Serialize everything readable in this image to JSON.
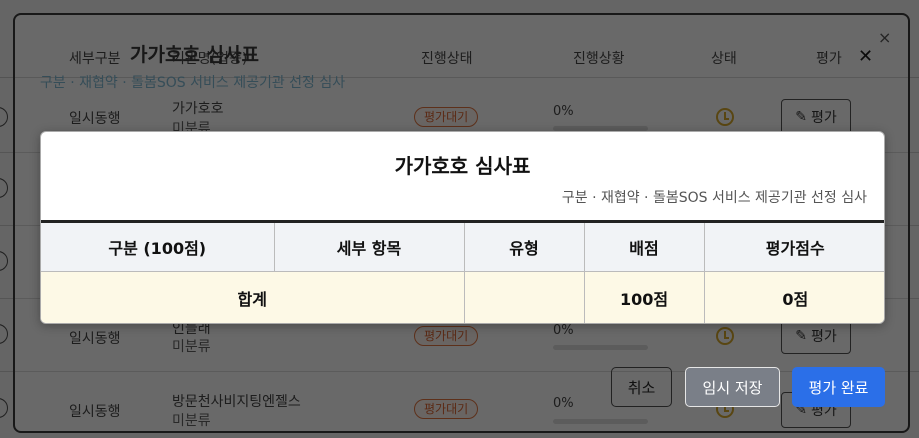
{
  "background": {
    "headers": {
      "detail_category": "세부구분",
      "org_name": "기관명(업종)",
      "progress_status": "진행상태",
      "progress_state": "진행상황",
      "state": "상태",
      "evaluate": "평가"
    },
    "rows": [
      {
        "category": "일시동행",
        "name": "가가호호",
        "sub": "미분류",
        "badge": "평가대기",
        "percent": "0%",
        "eval_label": "평가"
      },
      {
        "category": "",
        "name": "",
        "sub": "",
        "badge": "",
        "percent": "",
        "eval_label": ""
      },
      {
        "category": "",
        "name": "",
        "sub": "",
        "badge": "",
        "percent": "",
        "eval_label": ""
      },
      {
        "category": "일시동행",
        "name": "인들래",
        "sub": "미분류",
        "badge": "평가대기",
        "percent": "0%",
        "eval_label": "평가"
      },
      {
        "category": "일시동행",
        "name": "방문천사비지팅엔젤스",
        "sub": "미분류",
        "badge": "평가대기",
        "percent": "0%",
        "eval_label": "평가"
      }
    ]
  },
  "outer_dialog": {
    "title": "가가호호 심사표",
    "subtitle": "구분 · 재협약 · 돌봄SOS 서비스 제공기관 선정 심사",
    "close_glyph": "×",
    "close_glyph2": "✕"
  },
  "modal": {
    "title": "가가호호 심사표",
    "subtitle": "구분 · 재협약 · 돌봄SOS 서비스 제공기관 선정 심사",
    "table": {
      "headers": [
        "구분 (100점)",
        "세부 항목",
        "유형",
        "배점",
        "평가점수"
      ],
      "total_row": {
        "label": "합계",
        "type": "",
        "allotted": "100점",
        "score": "0점"
      }
    }
  },
  "footer": {
    "cancel": "취소",
    "temp_save": "임시 저장",
    "complete": "평가 완료"
  },
  "colors": {
    "primary_button": "#2b6fe8",
    "secondary_button": "#7a7f88",
    "total_row_bg": "#fdf9e6",
    "badge_orange": "#d9541b",
    "clock_yellow": "#d4a017"
  },
  "icons": {
    "pencil": "✎",
    "clock": "clock-icon"
  }
}
